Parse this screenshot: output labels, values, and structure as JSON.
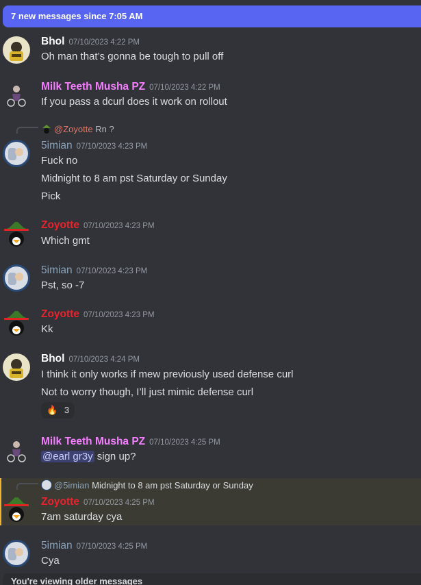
{
  "banner": {
    "text": "7 new messages since 7:05 AM"
  },
  "footer": {
    "text": "You're viewing older messages"
  },
  "colors": {
    "bhol": "#ffffff",
    "milk": "#f47fff",
    "zoyotte": "#e8242e",
    "simian": "#8aa2b8"
  },
  "messages": [
    {
      "author": "Bhol",
      "time": "07/10/2023 4:22 PM",
      "lines": [
        "Oh man that’s gonna be tough to pull off"
      ]
    },
    {
      "author": "Milk Teeth Musha PZ",
      "time": "07/10/2023 4:22 PM",
      "lines": [
        "If you pass a dcurl does it work on rollout"
      ]
    },
    {
      "reply_to": "@Zoyotte",
      "reply_text": "Rn ?",
      "author": "5imian",
      "time": "07/10/2023 4:23 PM",
      "lines": [
        "Fuck no",
        "Midnight to 8 am pst Saturday or Sunday",
        "Pick"
      ]
    },
    {
      "author": "Zoyotte",
      "time": "07/10/2023 4:23 PM",
      "lines": [
        "Which gmt"
      ]
    },
    {
      "author": "5imian",
      "time": "07/10/2023 4:23 PM",
      "lines": [
        "Pst, so -7"
      ]
    },
    {
      "author": "Zoyotte",
      "time": "07/10/2023 4:23 PM",
      "lines": [
        "Kk"
      ]
    },
    {
      "author": "Bhol",
      "time": "07/10/2023 4:24 PM",
      "lines": [
        "I think it only works if mew previously used defense curl",
        "Not to worry though, I’ll just mimic defense curl"
      ],
      "reaction": {
        "emoji": "🔥",
        "count": "3"
      }
    },
    {
      "author": "Milk Teeth Musha PZ",
      "time": "07/10/2023 4:25 PM",
      "mention": "@earl gr3y",
      "after_mention": " sign up?"
    },
    {
      "reply_to": "@5imian",
      "reply_text": "Midnight to 8 am pst Saturday or Sunday",
      "author": "Zoyotte",
      "time": "07/10/2023 4:25 PM",
      "lines": [
        "7am saturday cya"
      ]
    },
    {
      "author": "5imian",
      "time": "07/10/2023 4:25 PM",
      "lines": [
        "Cya"
      ]
    }
  ]
}
